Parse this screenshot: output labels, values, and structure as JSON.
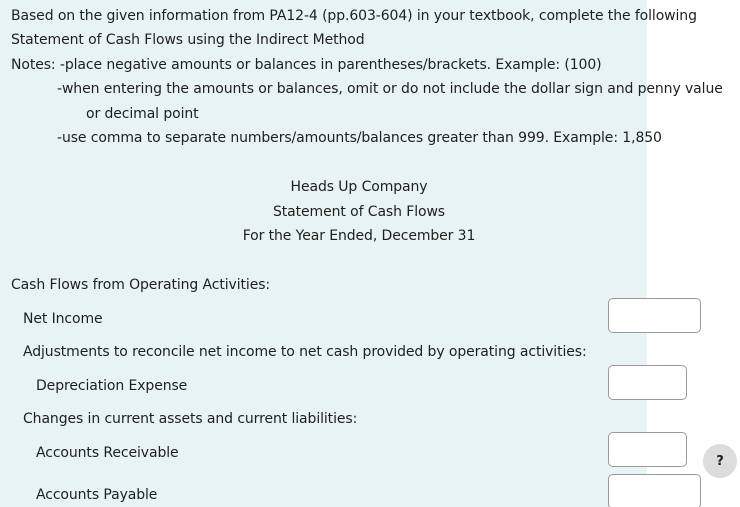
{
  "instructions": {
    "line1": "Based on the given information from PA12-4 (pp.603-604) in your textbook, complete the following",
    "line2": "Statement of Cash Flows using the Indirect Method",
    "line3": "Notes: -place negative amounts or balances  in parentheses/brackets. Example: (100)",
    "line4": "-when entering the amounts or balances, omit or do not include the dollar sign and penny value",
    "line5": "or decimal point",
    "line6": "-use comma to separate numbers/amounts/balances greater than 999. Example: 1,850"
  },
  "statement_header": {
    "company": "Heads Up Company",
    "title": "Statement of Cash Flows",
    "period": "For the Year Ended, December 31"
  },
  "operating": {
    "section_title": "Cash Flows from Operating Activities:",
    "net_income_label": "Net Income",
    "net_income_value": "",
    "adjustments_label": "Adjustments to reconcile net income to net cash provided by operating activities:",
    "depreciation_label": "Depreciation Expense",
    "depreciation_value": "",
    "changes_label": "Changes in current assets and current liabilities:",
    "accounts_receivable_label": "Accounts Receivable",
    "accounts_receivable_value": "",
    "accounts_payable_label": "Accounts Payable",
    "accounts_payable_value": ""
  },
  "help": {
    "label": "?",
    "icon": "question-mark-icon"
  },
  "colors": {
    "question_background": "#e7f3f5",
    "input_border": "#9a9a9a",
    "help_button": "#dcdcdc"
  }
}
